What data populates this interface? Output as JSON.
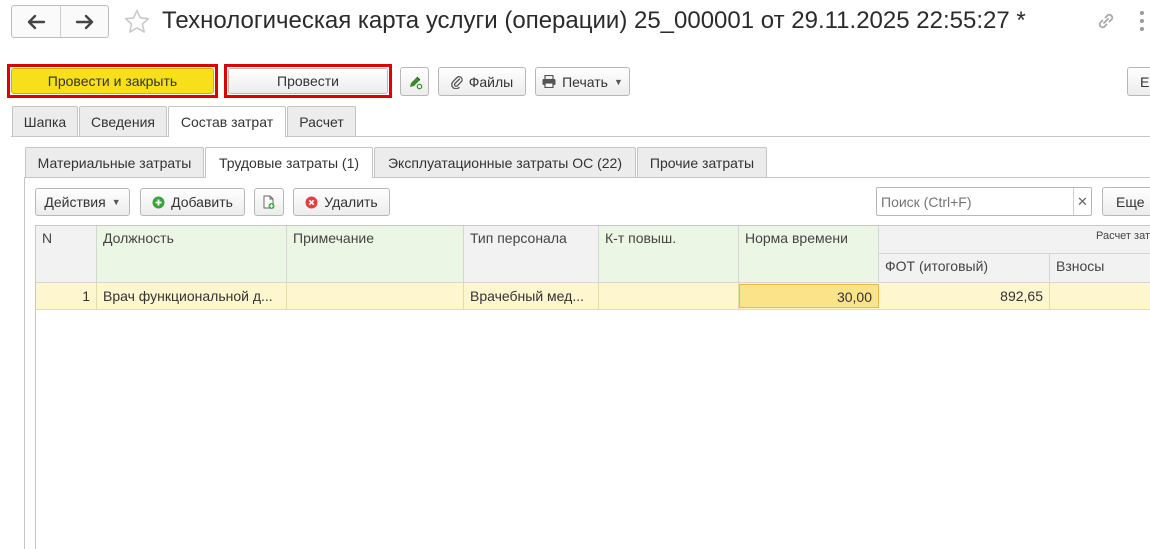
{
  "window": {
    "title": "Технологическая карта услуги (операции) 25_000001 от 29.11.2025 22:55:27 *",
    "back_icon": "arrow-left-icon",
    "forward_icon": "arrow-right-icon",
    "favorite_icon": "star-icon",
    "link_icon": "link-icon",
    "menu_icon": "more-vertical-icon"
  },
  "toolbar": {
    "post_close_label": "Провести и закрыть",
    "post_label": "Провести",
    "files_label": "Файлы",
    "print_label": "Печать",
    "right_label": "Е"
  },
  "tabs": [
    "Шапка",
    "Сведения",
    "Состав затрат",
    "Расчет"
  ],
  "subtabs": [
    "Материальные затраты",
    "Трудовые затраты (1)",
    "Эксплуатационные затраты ОС (22)",
    "Прочие затраты"
  ],
  "table_toolbar": {
    "actions_label": "Действия",
    "add_label": "Добавить",
    "delete_label": "Удалить",
    "search_placeholder": "Поиск (Ctrl+F)",
    "more_label": "Еще"
  },
  "table": {
    "headers": {
      "n": "N",
      "position": "Должность",
      "note": "Примечание",
      "staff_type": "Тип персонала",
      "coef": "К-т повыш.",
      "time_norm": "Норма времени",
      "calc_group": "Расчет зат",
      "fot": "ФОТ (итоговый)",
      "contrib": "Взносы"
    },
    "rows": [
      {
        "n": "1",
        "position": "Врач функциональной д...",
        "note": "",
        "staff_type": "Врачебный мед...",
        "coef": "",
        "time_norm": "30,00",
        "fot": "892,65",
        "contrib": ""
      }
    ]
  },
  "colors": {
    "primary_button": "#f7e01a",
    "highlight_frame": "#e00000",
    "selected_row": "#fdf6cf",
    "active_cell": "#fbe38a",
    "green_header": "#ebf7e4"
  }
}
